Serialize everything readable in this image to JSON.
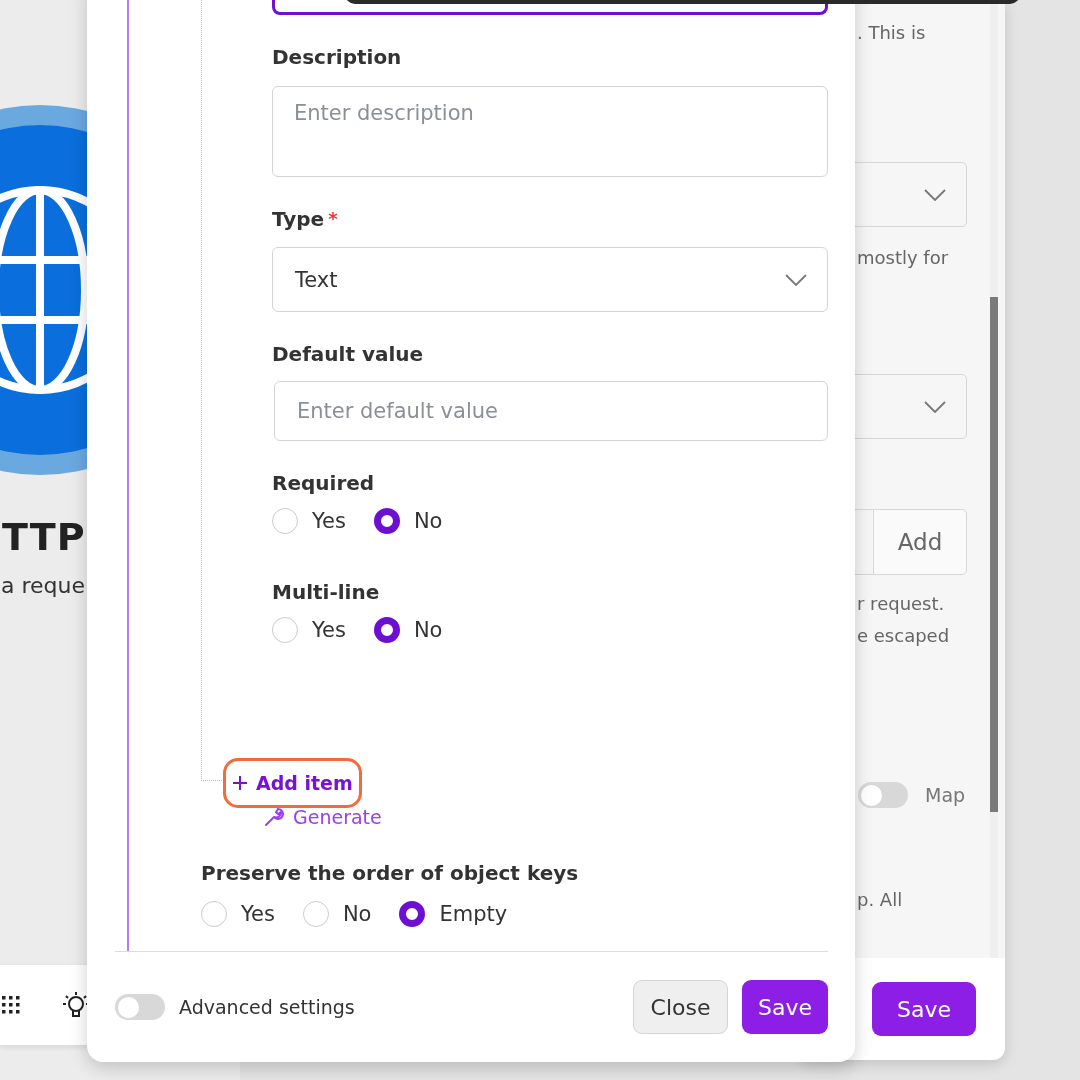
{
  "background_app": {
    "title": "TTP",
    "subtitle": "a reque"
  },
  "background_panel": {
    "hint_top": ". This is",
    "hint_middle": "mostly for",
    "add_button": "Add",
    "hint_lines": "r request.\ne escaped",
    "map_toggle": {
      "label": "Map",
      "on": false
    },
    "hint_bottom": "p. All",
    "save_button": "Save"
  },
  "dialog": {
    "fields": [
      {
        "kind": "textarea",
        "label": "Description",
        "placeholder": "Enter description"
      },
      {
        "kind": "select",
        "label": "Type",
        "required_mark": "*",
        "value": "Text"
      },
      {
        "kind": "input",
        "label": "Default value",
        "placeholder": "Enter default value"
      },
      {
        "kind": "radio",
        "label": "Required",
        "options": [
          {
            "label": "Yes",
            "selected": false
          },
          {
            "label": "No",
            "selected": true
          }
        ]
      },
      {
        "kind": "radio",
        "label": "Multi-line",
        "options": [
          {
            "label": "Yes",
            "selected": false
          },
          {
            "label": "No",
            "selected": true
          }
        ]
      }
    ],
    "add_item": {
      "label": "Add item",
      "highlighted": true
    },
    "generate": "Generate",
    "preserve_order": {
      "label": "Preserve the order of object keys",
      "options": [
        {
          "label": "Yes",
          "selected": false
        },
        {
          "label": "No",
          "selected": false
        },
        {
          "label": "Empty",
          "selected": true
        }
      ]
    },
    "advanced_settings": {
      "label": "Advanced settings",
      "on": false
    },
    "buttons": [
      {
        "label": "Close",
        "kind": "secondary"
      },
      {
        "label": "Save",
        "kind": "primary"
      }
    ]
  }
}
